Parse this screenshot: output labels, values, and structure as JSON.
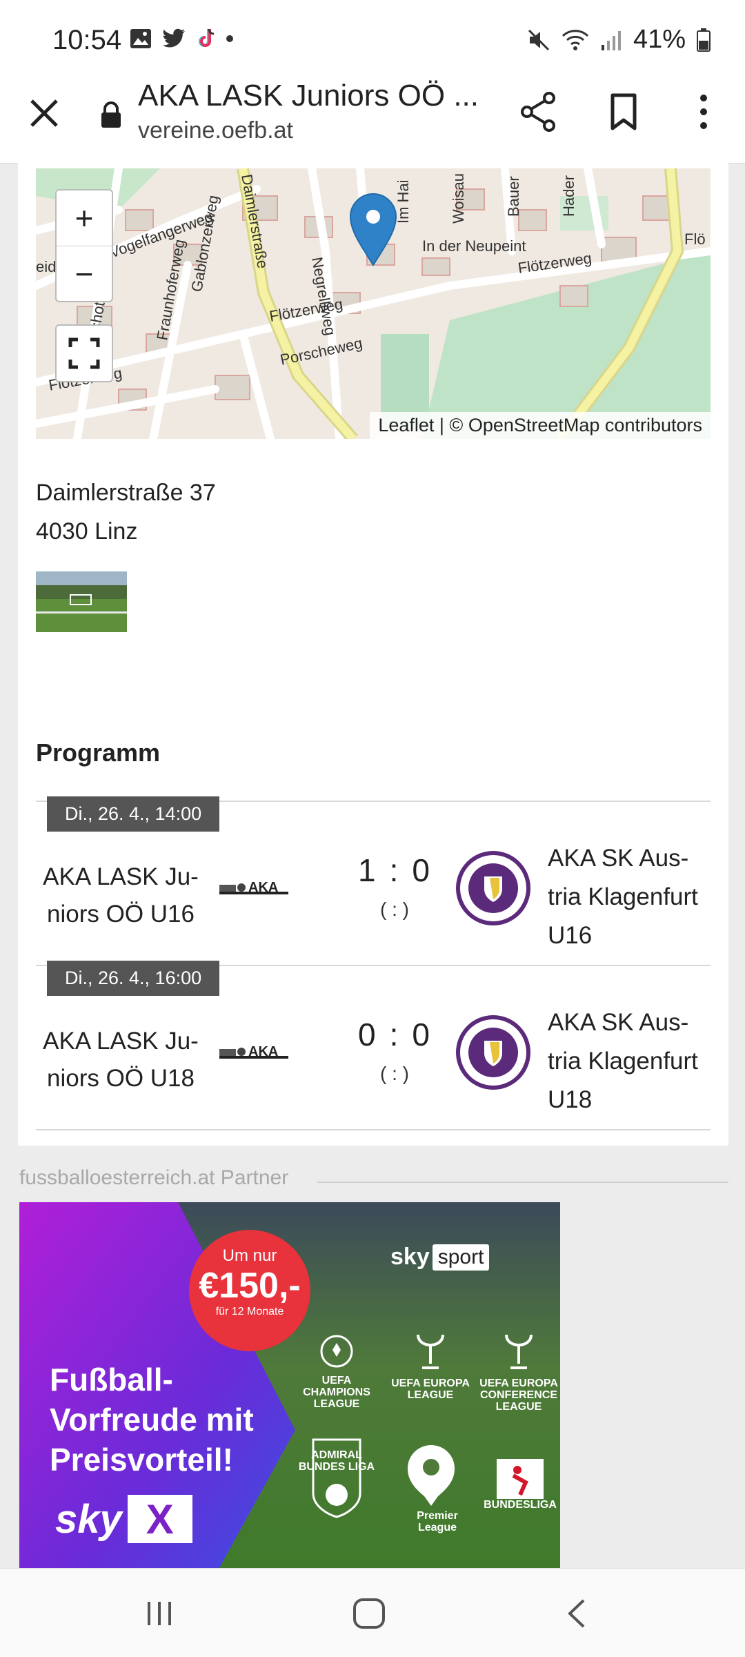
{
  "status_bar": {
    "time": "10:54",
    "battery": "41%"
  },
  "browser": {
    "title": "AKA LASK Juniors OÖ ...",
    "domain": "vereine.oefb.at"
  },
  "map": {
    "zoom_in": "+",
    "zoom_out": "−",
    "attribution_leaflet": "Leaflet",
    "attribution_sep": " | © ",
    "attribution_osm": "OpenStreetMap",
    "attribution_rest": " contributors",
    "street_labels": [
      "Flötzerweg",
      "Flötzerweg",
      "In der Neupeint",
      "Porscheweg",
      "Schottweg",
      "Gablonzerweg",
      "Fraunhoferweg",
      "Vogelfangerweg",
      "Negrelliweg",
      "Im Hai",
      "Woisau",
      "Bauer",
      "Hader",
      "Daimlerstraße",
      "Flö",
      "eid",
      "Flötzerweg"
    ]
  },
  "address": {
    "line1": "Daimlerstraße 37",
    "line2": "4030 Linz"
  },
  "program": {
    "title": "Programm",
    "matches": [
      {
        "date": "Di., 26. 4., 14:00",
        "home": "AKA LASK Ju-\nniors OÖ U16",
        "home_l1": "AKA LASK Ju-",
        "home_l2": "niors OÖ U16",
        "home_score": "1",
        "separator": ":",
        "away_score": "0",
        "half_time": "( : )",
        "away_l1": "AKA SK Aus-",
        "away_l2": "tria Klagenfurt",
        "away_l3": "U16"
      },
      {
        "date": "Di., 26. 4., 16:00",
        "home_l1": "AKA LASK Ju-",
        "home_l2": "niors OÖ U18",
        "home_score": "0",
        "separator": ":",
        "away_score": "0",
        "half_time": "( : )",
        "away_l1": "AKA SK Aus-",
        "away_l2": "tria Klagenfurt",
        "away_l3": "U18"
      }
    ]
  },
  "partner": {
    "label": "fussballoesterreich.at Partner",
    "ad": {
      "circle_top": "Um nur",
      "circle_price": "€150,-",
      "circle_bottom": "für 12 Monate",
      "brand_sky": "sky",
      "brand_sport": "sport",
      "headline_l1": "Fußball-",
      "headline_l2": "Vorfreude mit",
      "headline_l3": "Preisvorteil!",
      "logo_ucl": "UEFA CHAMPIONS LEAGUE",
      "logo_uel": "UEFA EUROPA LEAGUE",
      "logo_uecl": "UEFA EUROPA CONFERENCE LEAGUE",
      "logo_admiral": "ADMIRAL BUNDES LIGA",
      "logo_pl": "Premier League",
      "logo_bl": "BUNDESLIGA",
      "skyx_sky": "sky",
      "skyx_x": "X"
    }
  }
}
